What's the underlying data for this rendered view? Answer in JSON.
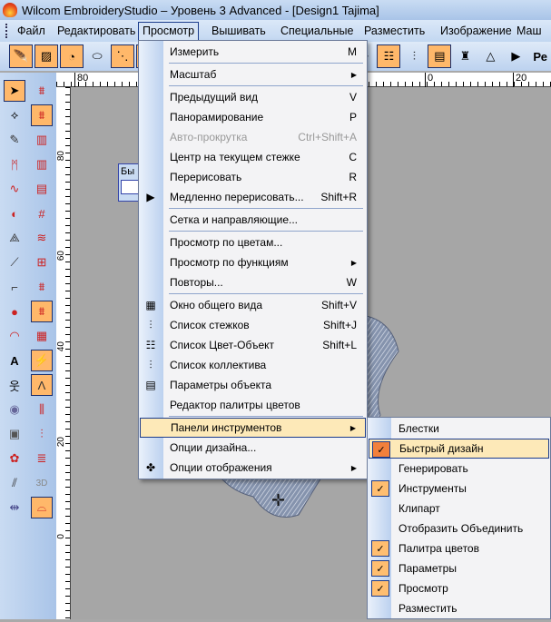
{
  "title": "Wilcom EmbroideryStudio – Уровень 3 Advanced - [Design1         Tajima]",
  "menubar": [
    "Файл",
    "Редактировать",
    "Просмотр",
    "Вышивать",
    "Специальные",
    "Разместить",
    "Изображение",
    "Маш"
  ],
  "toolbar_cut": "Ре",
  "ruler": {
    "top": [
      "80",
      "0",
      "20"
    ],
    "left": [
      "80",
      "60",
      "40",
      "20",
      "0"
    ]
  },
  "floating_toolbar": "Бы",
  "view_menu": [
    {
      "label": "Измерить",
      "shortcut": "M"
    },
    {
      "sep": true
    },
    {
      "label": "Масштаб",
      "submenu": true
    },
    {
      "sep": true
    },
    {
      "label": "Предыдущий вид",
      "shortcut": "V"
    },
    {
      "label": "Панорамирование",
      "shortcut": "P"
    },
    {
      "label": "Авто-прокрутка",
      "shortcut": "Ctrl+Shift+A",
      "disabled": true
    },
    {
      "label": "Центр на текущем стежке",
      "shortcut": "C"
    },
    {
      "label": "Перерисовать",
      "shortcut": "R"
    },
    {
      "label": "Медленно перерисовать...",
      "shortcut": "Shift+R",
      "icon": "slow-redraw-icon"
    },
    {
      "sep": true
    },
    {
      "label": "Сетка и направляющие..."
    },
    {
      "sep": true
    },
    {
      "label": "Просмотр по цветам..."
    },
    {
      "label": "Просмотр по функциям",
      "submenu": true
    },
    {
      "label": "Повторы...",
      "shortcut": "W"
    },
    {
      "sep": true
    },
    {
      "label": "Окно общего вида",
      "shortcut": "Shift+V",
      "icon": "overview-window-icon"
    },
    {
      "label": "Список стежков",
      "shortcut": "Shift+J",
      "icon": "stitch-list-icon"
    },
    {
      "label": "Список Цвет-Объект",
      "shortcut": "Shift+L",
      "icon": "color-object-list-icon"
    },
    {
      "label": "Список коллектива",
      "icon": "team-list-icon"
    },
    {
      "label": "Параметры объекта",
      "icon": "object-properties-icon"
    },
    {
      "label": "Редактор палитры цветов"
    },
    {
      "sep": true
    },
    {
      "label": "Панели инструментов",
      "submenu": true,
      "highlighted": true
    },
    {
      "label": "Опции дизайна..."
    },
    {
      "label": "Опции отображения",
      "submenu": true,
      "icon": "display-options-icon"
    }
  ],
  "toolbars_submenu": [
    {
      "label": "Блестки",
      "checked": false
    },
    {
      "label": "Быстрый дизайн",
      "checked": true,
      "highlighted": true
    },
    {
      "label": "Генерировать",
      "checked": false
    },
    {
      "label": "Инструменты",
      "checked": true
    },
    {
      "label": "Клипарт",
      "checked": false
    },
    {
      "label": "Отобразить Объединить",
      "checked": false
    },
    {
      "label": "Палитра цветов",
      "checked": true
    },
    {
      "label": "Параметры",
      "checked": true
    },
    {
      "label": "Просмотр",
      "checked": true
    },
    {
      "label": "Разместить",
      "checked": false
    }
  ],
  "check_glyph": "✓",
  "arrow_glyph": "▶"
}
